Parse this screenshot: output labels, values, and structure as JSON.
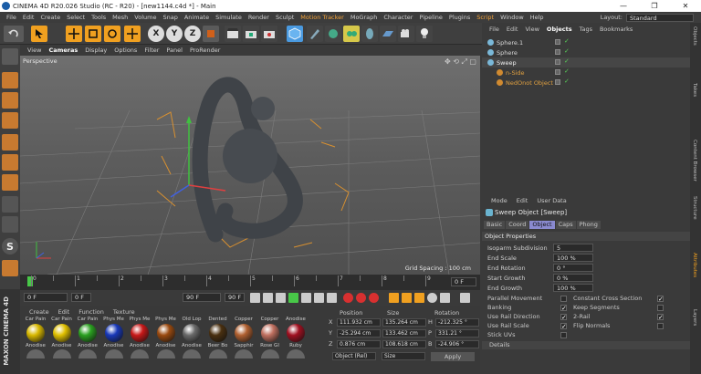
{
  "window": {
    "title": "CINEMA 4D R20.026 Studio (RC - R20) - [new1144.c4d *] - Main",
    "minimize": "—",
    "restore": "❐",
    "close": "✕"
  },
  "menu": [
    "File",
    "Edit",
    "Create",
    "Select",
    "Tools",
    "Mesh",
    "Volume",
    "Snap",
    "Animate",
    "Simulate",
    "Render",
    "Sculpt",
    "Motion Tracker",
    "MoGraph",
    "Character",
    "Pipeline",
    "Plugins",
    "Script",
    "Window",
    "Help"
  ],
  "menu_highlight": [
    "Motion Tracker",
    "Script"
  ],
  "layout": {
    "label": "Layout:",
    "value": "Standard"
  },
  "toolbar": {
    "x": "X",
    "y": "Y",
    "z": "Z"
  },
  "viewport_menu": [
    "View",
    "Cameras",
    "Display",
    "Options",
    "Filter",
    "Panel",
    "ProRender"
  ],
  "viewport_menu_active": "Cameras",
  "viewport": {
    "label": "Perspective",
    "grid": "Grid Spacing : 100 cm"
  },
  "timeline": {
    "ticks": [
      "0",
      "",
      "1",
      "",
      "2",
      "",
      "3",
      "",
      "4",
      "",
      "5",
      "",
      "6",
      "",
      "7",
      "",
      "8",
      "",
      "9"
    ],
    "frame": "0 F"
  },
  "transport": {
    "start": "0 F",
    "current": "0 F",
    "end": "90 F",
    "end2": "90 F"
  },
  "material_menu": [
    "Create",
    "Edit",
    "Function",
    "Texture"
  ],
  "materials": [
    {
      "top": "Car Pain",
      "bottom": "Anodise",
      "color": "#d8b800"
    },
    {
      "top": "Car Pain",
      "bottom": "Anodise",
      "color": "#e0c000"
    },
    {
      "top": "Car Pain",
      "bottom": "Anodise",
      "color": "#2aa020"
    },
    {
      "top": "Phys Me",
      "bottom": "Anodise",
      "color": "#1838b8"
    },
    {
      "top": "Phys Me",
      "bottom": "Anodise",
      "color": "#c81818"
    },
    {
      "top": "Phys Me",
      "bottom": "Anodise",
      "color": "#9a4a10"
    },
    {
      "top": "Old Lop",
      "bottom": "Anodise",
      "color": "#6a6a6a"
    },
    {
      "top": "Dented",
      "bottom": "Beer Bo",
      "color": "#4a3010"
    },
    {
      "top": "Copper",
      "bottom": "Sapphir",
      "color": "#b06030"
    },
    {
      "top": "Copper",
      "bottom": "Rose Gl",
      "color": "#c07060"
    },
    {
      "top": "Anodise",
      "bottom": "Ruby",
      "color": "#a01020"
    }
  ],
  "coords": {
    "headers": [
      "Position",
      "Size",
      "Rotation"
    ],
    "rows": [
      {
        "axis": "X",
        "pos": "111.932 cm",
        "size": "135.264 cm",
        "rot_label": "H",
        "rot": "-212.325 °"
      },
      {
        "axis": "Y",
        "pos": "-25.294 cm",
        "size": "133.462 cm",
        "rot_label": "P",
        "rot": "331.21 °"
      },
      {
        "axis": "Z",
        "pos": "0.876 cm",
        "size": "108.618 cm",
        "rot_label": "B",
        "rot": "-24.906 °"
      }
    ],
    "mode": "Object (Rel)",
    "size_mode": "Size",
    "apply": "Apply"
  },
  "objects_menu": [
    "File",
    "Edit",
    "View",
    "Objects",
    "Tags",
    "Bookmarks"
  ],
  "objects_menu_active": "Objects",
  "objects": [
    {
      "name": "Sphere.1",
      "indent": 0,
      "color": "#d8d8d8"
    },
    {
      "name": "Sphere",
      "indent": 0,
      "color": "#d8d8d8"
    },
    {
      "name": "Sweep",
      "indent": 0,
      "color": "#f0f0f0"
    },
    {
      "name": "n-Side",
      "indent": 1,
      "color": "#e0a040"
    },
    {
      "name": "NedOnot Object",
      "indent": 1,
      "color": "#e0a040"
    }
  ],
  "side_tabs": [
    "Objects",
    "Takes",
    "Content Browser",
    "Structure",
    "Attributes",
    "Layers"
  ],
  "attr_menu": [
    "Mode",
    "Edit",
    "User Data"
  ],
  "attr_title": "Sweep Object [Sweep]",
  "attr_tabs": [
    "Basic",
    "Coord",
    "Object",
    "Caps",
    "Phong"
  ],
  "attr_tab_active": "Object",
  "attr_section": "Object Properties",
  "props": [
    {
      "label": "Isoparm Subdivision",
      "value": "5"
    },
    {
      "label": "End Scale",
      "value": "100 %"
    },
    {
      "label": "End Rotation",
      "value": "0 °"
    },
    {
      "label": "Start Growth",
      "value": "0 %"
    },
    {
      "label": "End Growth",
      "value": "100 %"
    }
  ],
  "bools_left": [
    {
      "label": "Parallel Movement",
      "checked": ""
    },
    {
      "label": "Banking",
      "checked": "✓"
    },
    {
      "label": "Use Rail Direction",
      "checked": "✓"
    },
    {
      "label": "Use Rail Scale",
      "checked": "✓"
    },
    {
      "label": "Stick UVs",
      "checked": ""
    }
  ],
  "bools_right": [
    {
      "label": "Constant Cross Section",
      "checked": "✓"
    },
    {
      "label": "Keep Segments",
      "checked": ""
    },
    {
      "label": "2-Rail",
      "checked": "✓"
    },
    {
      "label": "Flip Normals",
      "checked": ""
    }
  ],
  "details": "Details",
  "logo": "MAXON CINEMA 4D"
}
